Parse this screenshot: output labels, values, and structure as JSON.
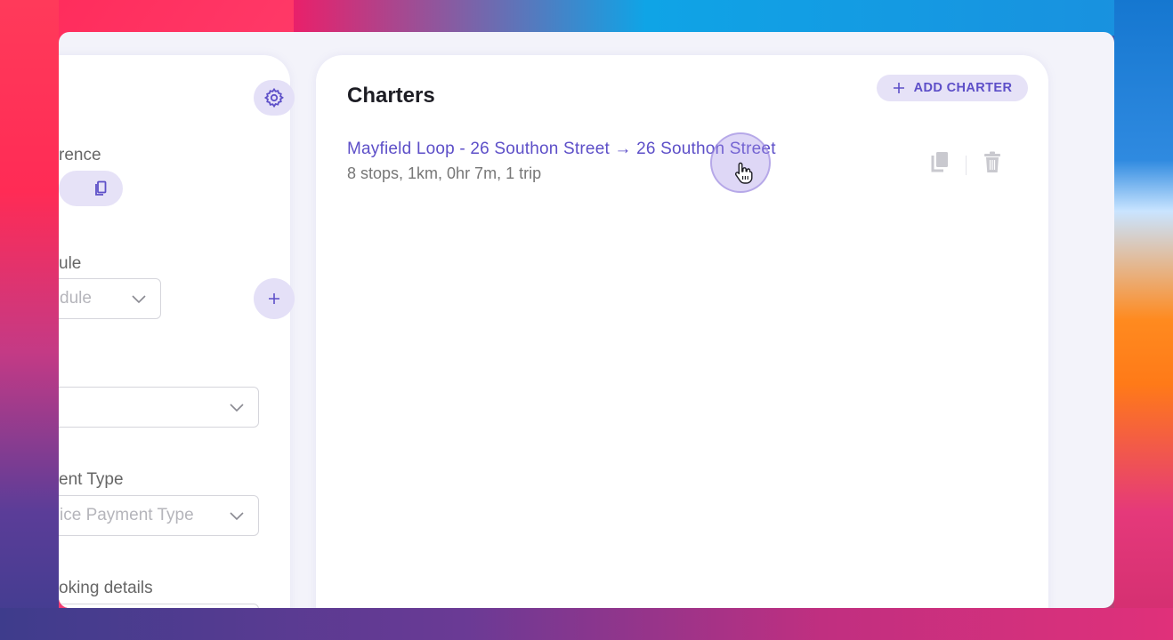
{
  "left_panel": {
    "field1_label": "rence",
    "field2_label": "ule",
    "field2_placeholder": "dule",
    "field4_label": "ent Type",
    "field4_placeholder": "ice Payment Type",
    "field5_label": "oking details"
  },
  "charters": {
    "title": "Charters",
    "add_label": "ADD CHARTER",
    "items": [
      {
        "title": "Mayfield Loop - 26 Southon Street → 26 Southon Street",
        "subtitle": "8 stops, 1km, 0hr 7m, 1 trip"
      }
    ]
  },
  "colors": {
    "accent": "#5d4fc8",
    "accent_soft": "#e4e0f7",
    "panel_bg": "#f3f3fa"
  },
  "icons": {
    "settings": "gear-icon",
    "copy": "copy-icon",
    "duplicate": "duplicate-icon",
    "delete": "trash-icon",
    "add": "plus-icon",
    "dropdown": "chevron-down-icon",
    "cursor": "hand-pointer-icon"
  }
}
